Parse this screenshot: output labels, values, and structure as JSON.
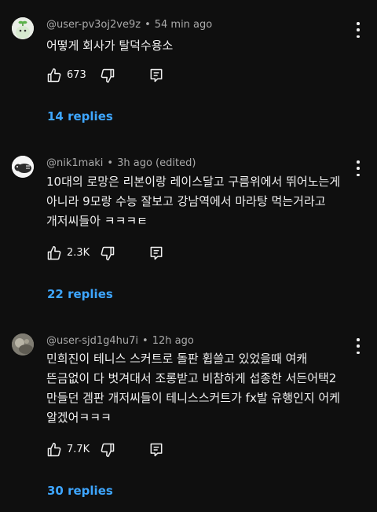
{
  "comments": [
    {
      "author": "@user-pv3oj2ve9z",
      "time": "54 min ago",
      "text": "어떻게 회사가 탈덕수용소",
      "likes": "673",
      "replies": "14 replies"
    },
    {
      "author": "@nik1maki",
      "time": "3h ago (edited)",
      "text": "10대의 로망은 리본이랑 레이스달고 구름위에서 뛰어노는게 아니라 9모랑 수능 잘보고 강남역에서 마라탕 먹는거라고 개저씨들아 ㅋㅋㅋㅌ",
      "likes": "2.3K",
      "replies": "22 replies"
    },
    {
      "author": "@user-sjd1g4hu7i",
      "time": "12h ago",
      "text": "민희진이 테니스 스커트로 돌판 휩쓸고 있었을때 여캐 뜬금없이 다 벗겨대서 조롱받고 비참하게 섭종한 서든어택2 만들던 겜판 개저씨들이 테니스스커트가 fx발 유행인지 어케 알겠어ㅋㅋㅋ",
      "likes": "7.7K",
      "replies": "30 replies"
    }
  ],
  "separator": "•",
  "colors": {
    "background": "#0f0f0f",
    "text": "#f1f1f1",
    "meta": "#aaaaaa",
    "link": "#3ea6ff"
  },
  "icons": [
    "avatar",
    "more-vert-icon",
    "thumb-up-icon",
    "thumb-down-icon",
    "reply-comment-icon"
  ]
}
